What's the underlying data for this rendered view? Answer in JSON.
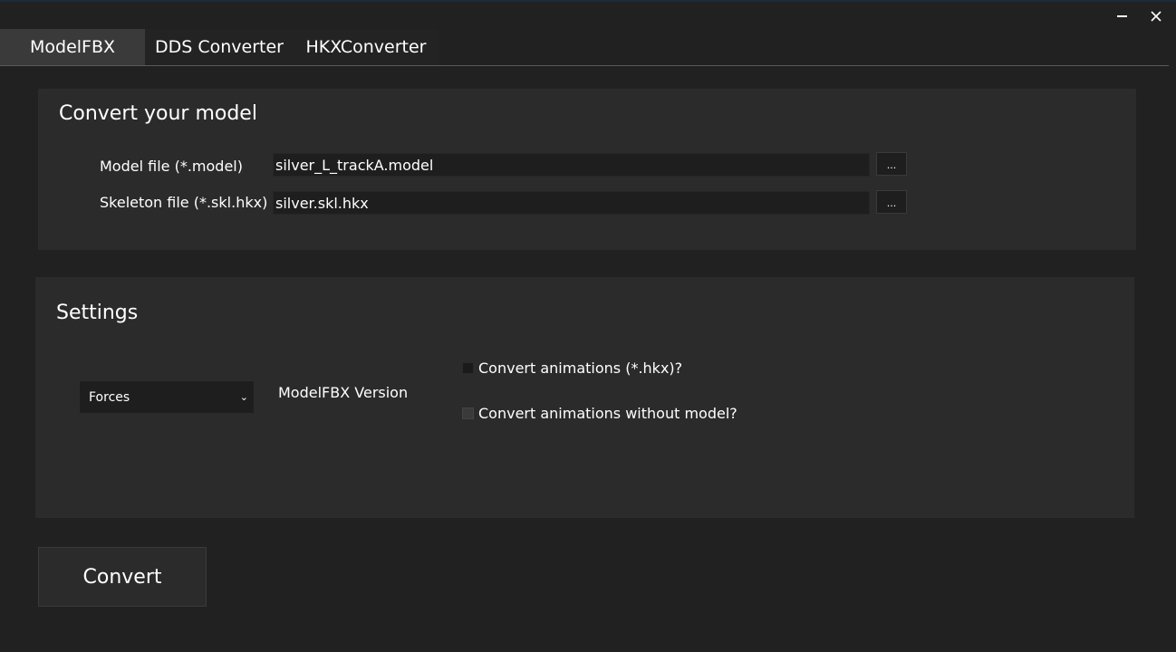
{
  "window": {
    "minimize_symbol": "—",
    "close_symbol": "✕"
  },
  "tabs": [
    {
      "label": "ModelFBX",
      "active": true
    },
    {
      "label": "DDS Converter",
      "active": false
    },
    {
      "label": "HKXConverter",
      "active": false
    }
  ],
  "convert_panel": {
    "title": "Convert your model",
    "model_file": {
      "label": "Model file (*.model)",
      "value": "silver_L_trackA.model",
      "browse_label": "..."
    },
    "skeleton_file": {
      "label": "Skeleton file (*.skl.hkx)",
      "value": "silver.skl.hkx",
      "browse_label": "..."
    }
  },
  "settings_panel": {
    "title": "Settings",
    "version_select": {
      "selected": "Forces",
      "label": "ModelFBX Version"
    },
    "convert_animations": {
      "label": "Convert animations (*.hkx)?",
      "checked": false
    },
    "convert_animations_without_model": {
      "label": "Convert animations without model?",
      "checked": false
    }
  },
  "actions": {
    "convert_label": "Convert"
  },
  "icons": {
    "minimize": "minimize-icon",
    "close": "close-icon",
    "dropdown": "chevron-down-icon"
  },
  "colors": {
    "background": "#212121",
    "panel": "#2c2b2c",
    "active_tab": "#3a3a3a",
    "input": "#1e1e1e"
  }
}
